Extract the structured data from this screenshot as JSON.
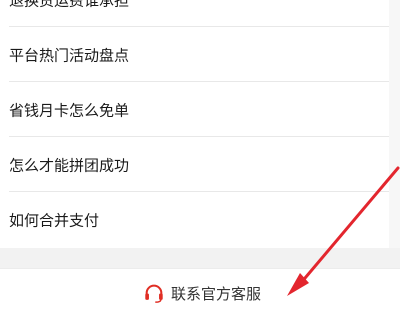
{
  "faq": {
    "items": [
      {
        "label": "退换货运费谁承担"
      },
      {
        "label": "平台热门活动盘点"
      },
      {
        "label": "省钱月卡怎么免单"
      },
      {
        "label": "怎么才能拼团成功"
      },
      {
        "label": "如何合并支付"
      }
    ]
  },
  "footer": {
    "service_label": "联系官方客服",
    "icon": "headset-icon"
  },
  "colors": {
    "accent": "#e02e24",
    "arrow": "#e3262e",
    "text": "#1a1a1a",
    "background": "#f2f2f2"
  }
}
